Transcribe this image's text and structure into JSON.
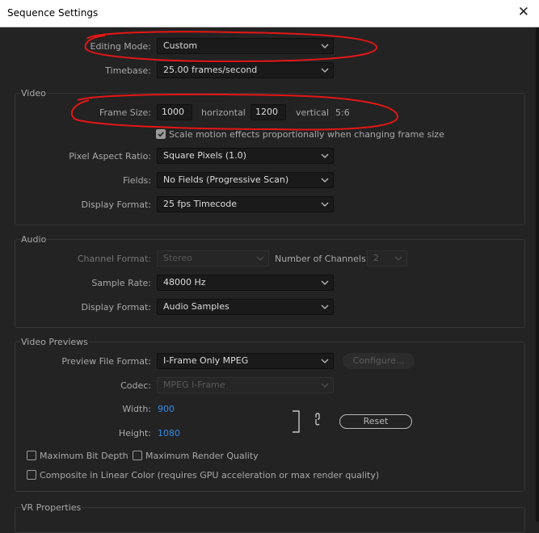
{
  "window": {
    "title": "Sequence Settings",
    "close_glyph": "✕"
  },
  "editing_mode": {
    "label": "Editing Mode:",
    "value": "Custom"
  },
  "timebase": {
    "label": "Timebase:",
    "value": "25.00  frames/second"
  },
  "video": {
    "title": "Video",
    "frame_size_label": "Frame Size:",
    "width": "1000",
    "horizontal_label": "horizontal",
    "height": "1200",
    "vertical_label": "vertical",
    "aspect": "5:6",
    "scale_checkbox_label": "Scale motion effects proportionally when changing frame size",
    "scale_checked": true,
    "par_label": "Pixel Aspect Ratio:",
    "par_value": "Square Pixels (1.0)",
    "fields_label": "Fields:",
    "fields_value": "No Fields (Progressive Scan)",
    "display_format_label": "Display Format:",
    "display_format_value": "25 fps Timecode"
  },
  "audio": {
    "title": "Audio",
    "channel_format_label": "Channel Format:",
    "channel_format_value": "Stereo",
    "num_channels_label": "Number of Channels:",
    "num_channels_value": "2",
    "sample_rate_label": "Sample Rate:",
    "sample_rate_value": "48000 Hz",
    "display_format_label": "Display Format:",
    "display_format_value": "Audio Samples"
  },
  "video_previews": {
    "title": "Video Previews",
    "preview_format_label": "Preview File Format:",
    "preview_format_value": "I-Frame Only MPEG",
    "configure_label": "Configure...",
    "codec_label": "Codec:",
    "codec_value": "MPEG I-Frame",
    "width_label": "Width:",
    "width_value": "900",
    "height_label": "Height:",
    "height_value": "1080",
    "reset_label": "Reset",
    "max_bit_depth_label": "Maximum Bit Depth",
    "max_render_quality_label": "Maximum Render Quality",
    "linear_color_label": "Composite in Linear Color (requires GPU acceleration or max render quality)"
  },
  "vr": {
    "title": "VR Properties"
  },
  "colors": {
    "annotation": "#e41616",
    "accent_blue": "#2d8ceb"
  }
}
